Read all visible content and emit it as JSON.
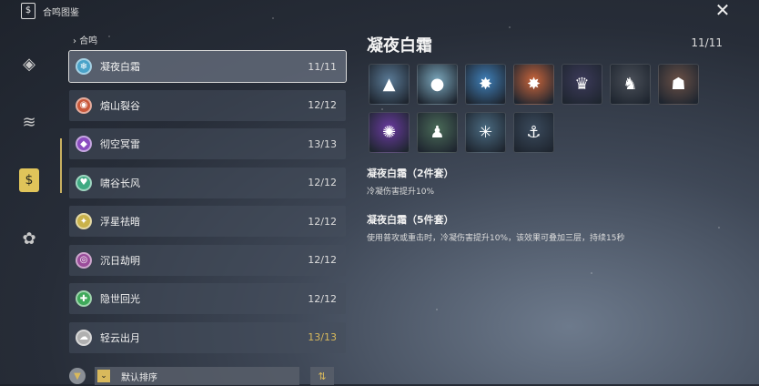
{
  "header": {
    "title": "合鸣图鉴",
    "app_icon": "sonata-icon",
    "close_icon": "close-icon"
  },
  "rail": [
    {
      "icon": "diamond-icon",
      "glyph": "◈"
    },
    {
      "icon": "layers-icon",
      "glyph": "≋"
    },
    {
      "icon": "sonata-icon",
      "glyph": "$",
      "active": true
    },
    {
      "icon": "cluster-icon",
      "glyph": "✿"
    }
  ],
  "section": {
    "label": "合鸣"
  },
  "sets": [
    {
      "label": "凝夜白霜",
      "count": "11/11",
      "color": "#4aa3c9",
      "glyph": "❄",
      "selected": true
    },
    {
      "label": "熔山裂谷",
      "count": "12/12",
      "color": "#c9583a",
      "glyph": "◉"
    },
    {
      "label": "彻空冥雷",
      "count": "13/13",
      "color": "#8a4cc0",
      "glyph": "◆"
    },
    {
      "label": "啸谷长风",
      "count": "12/12",
      "color": "#3faa82",
      "glyph": "♥"
    },
    {
      "label": "浮星祛暗",
      "count": "12/12",
      "color": "#c9b24a",
      "glyph": "✦"
    },
    {
      "label": "沉日劫明",
      "count": "12/12",
      "color": "#9a4c9a",
      "glyph": "◎"
    },
    {
      "label": "隐世回光",
      "count": "12/12",
      "color": "#3fa95a",
      "glyph": "✚"
    },
    {
      "label": "轻云出月",
      "count": "13/13",
      "color": "#b0b0b0",
      "glyph": "☁",
      "gold": true
    }
  ],
  "bottom": {
    "filter_icon": "filter-icon",
    "sort_label": "默认排序",
    "sort_icon": "sort-icon"
  },
  "detail": {
    "title": "凝夜白霜",
    "count": "11/11",
    "echoes": [
      {
        "name": "echo-1",
        "color": "#5a7a96",
        "glyph": "▲"
      },
      {
        "name": "echo-2",
        "color": "#7aa6bb",
        "glyph": "●"
      },
      {
        "name": "echo-3",
        "color": "#3f7fb8",
        "glyph": "✸"
      },
      {
        "name": "echo-4",
        "color": "#c9643a",
        "glyph": "✸"
      },
      {
        "name": "echo-5",
        "color": "#3c3a5a",
        "glyph": "♛"
      },
      {
        "name": "echo-6",
        "color": "#4a4f58",
        "glyph": "♞"
      },
      {
        "name": "echo-7",
        "color": "#6a5046",
        "glyph": "☗"
      },
      {
        "name": "echo-8",
        "color": "#6a3aa0",
        "glyph": "✺"
      },
      {
        "name": "echo-9",
        "color": "#4a6a58",
        "glyph": "♟"
      },
      {
        "name": "echo-10",
        "color": "#4a6a80",
        "glyph": "✳"
      },
      {
        "name": "echo-11",
        "color": "#3a4a5c",
        "glyph": "⚓"
      }
    ],
    "set2_title": "凝夜白霜（2件套）",
    "set2_desc": "冷凝伤害提升10%",
    "set5_title": "凝夜白霜（5件套）",
    "set5_desc": "使用普攻或重击时，冷凝伤害提升10%，该效果可叠加三层，持续15秒"
  }
}
